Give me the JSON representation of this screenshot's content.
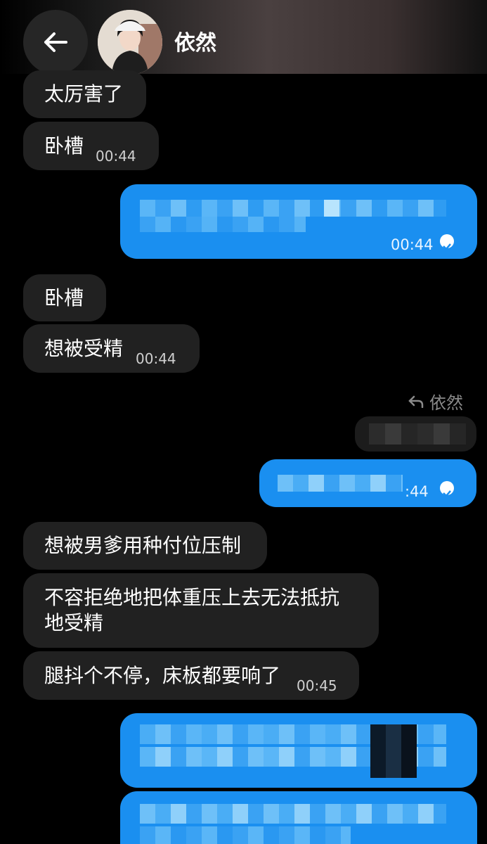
{
  "header": {
    "contact_name": "依然"
  },
  "messages": {
    "m1": {
      "text": "太厉害了"
    },
    "m2": {
      "text": "卧槽",
      "time": "00:44"
    },
    "m3": {
      "time": "00:44"
    },
    "m4": {
      "text": "卧槽"
    },
    "m5": {
      "text": "想被受精",
      "time": "00:44"
    },
    "m6": {
      "reply_to": "依然",
      "time": ":44"
    },
    "m7": {
      "text": "想被男爹用种付位压制"
    },
    "m8": {
      "text": "不容拒绝地把体重压上去无法抵抗地受精"
    },
    "m9": {
      "text": "腿抖个不停，床板都要响了",
      "time": "00:45"
    }
  },
  "colors": {
    "outgoing_bubble": "#1a8ff0",
    "incoming_bubble": "#212121",
    "background": "#000000"
  },
  "icons": {
    "back": "arrow-left-icon",
    "read": "check-circle-icon",
    "reply": "reply-arrow-icon"
  }
}
